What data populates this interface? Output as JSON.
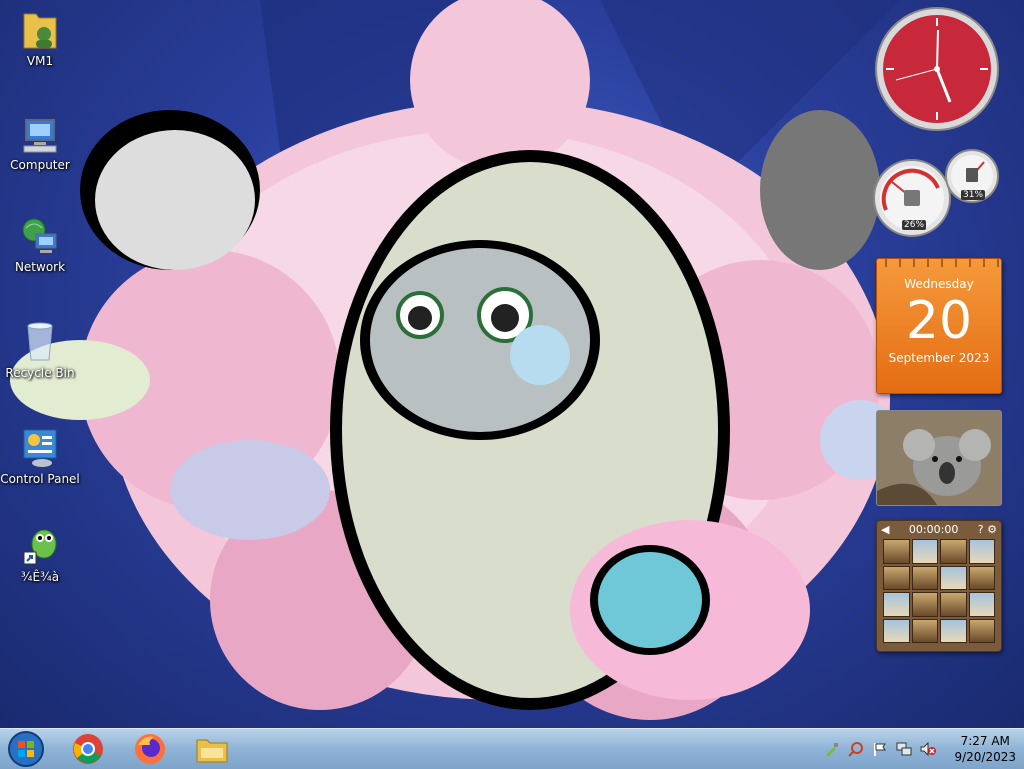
{
  "desktop": {
    "icons": [
      {
        "label": "VM1",
        "icon": "user-folder-icon"
      },
      {
        "label": "Computer",
        "icon": "computer-icon"
      },
      {
        "label": "Network",
        "icon": "network-icon"
      },
      {
        "label": "Recycle Bin",
        "icon": "recycle-bin-icon"
      },
      {
        "label": "Control Panel",
        "icon": "control-panel-icon"
      },
      {
        "label": "¾Ê¾à",
        "icon": "app-shortcut-icon"
      }
    ]
  },
  "gadgets": {
    "cpu": {
      "cpu_percent": "26%",
      "memory_percent": "31%"
    },
    "calendar": {
      "weekday": "Wednesday",
      "day": "20",
      "month_year": "September 2023"
    },
    "puzzle": {
      "timer": "00:00:00"
    }
  },
  "taskbar": {
    "pinned": [
      {
        "name": "chrome",
        "icon": "chrome-icon"
      },
      {
        "name": "firefox",
        "icon": "firefox-icon"
      },
      {
        "name": "explorer",
        "icon": "file-explorer-icon"
      }
    ],
    "clock": {
      "time": "7:27 AM",
      "date": "9/20/2023"
    }
  },
  "colors": {
    "taskbar": "#8fb3d6",
    "clock_face": "#c7283a",
    "calendar": "#e46c12"
  }
}
